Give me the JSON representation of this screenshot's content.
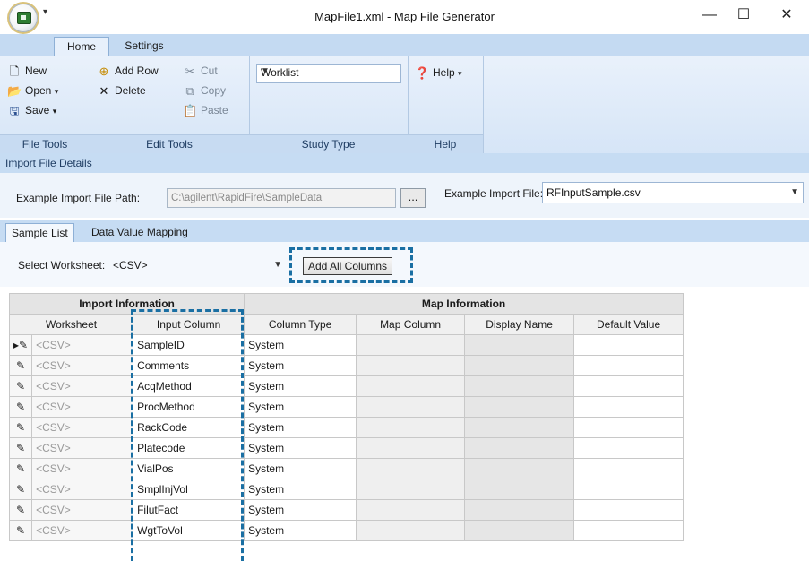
{
  "window": {
    "title": "MapFile1.xml - Map File Generator",
    "controls": {
      "minimize": "—",
      "maximize": "☐",
      "close": "✕"
    }
  },
  "ribbon": {
    "tabs": [
      "Home",
      "Settings"
    ],
    "active_tab": "Home",
    "file_tools": {
      "label": "File Tools",
      "new": "New",
      "open": "Open",
      "save": "Save"
    },
    "edit_tools": {
      "label": "Edit Tools",
      "add_row": "Add Row",
      "delete": "Delete",
      "cut": "Cut",
      "copy": "Copy",
      "paste": "Paste"
    },
    "study_type": {
      "label": "Study Type",
      "value": "Worklist"
    },
    "help": {
      "label": "Help",
      "button": "Help"
    }
  },
  "import_details": {
    "header": "Import File Details",
    "path_label": "Example Import File Path:",
    "path_value": "C:\\agilent\\RapidFire\\SampleData",
    "browse_label": "...",
    "file_label": "Example Import File:",
    "file_value": "RFInputSample.csv"
  },
  "subtabs": [
    "Sample List",
    "Data Value Mapping"
  ],
  "worksheet": {
    "label": "Select Worksheet:",
    "value": "<CSV>",
    "add_all_label": "Add All Columns"
  },
  "grid": {
    "group_headers": {
      "import": "Import Information",
      "map": "Map Information"
    },
    "columns": [
      "Worksheet",
      "Input Column",
      "Column Type",
      "Map Column",
      "Display Name",
      "Default Value"
    ],
    "rows": [
      {
        "worksheet": "<CSV>",
        "input": "SampleID",
        "type": "System"
      },
      {
        "worksheet": "<CSV>",
        "input": "Comments",
        "type": "System"
      },
      {
        "worksheet": "<CSV>",
        "input": "AcqMethod",
        "type": "System"
      },
      {
        "worksheet": "<CSV>",
        "input": "ProcMethod",
        "type": "System"
      },
      {
        "worksheet": "<CSV>",
        "input": "RackCode",
        "type": "System"
      },
      {
        "worksheet": "<CSV>",
        "input": "Platecode",
        "type": "System"
      },
      {
        "worksheet": "<CSV>",
        "input": "VialPos",
        "type": "System"
      },
      {
        "worksheet": "<CSV>",
        "input": "SmplInjVol",
        "type": "System"
      },
      {
        "worksheet": "<CSV>",
        "input": "FilutFact",
        "type": "System"
      },
      {
        "worksheet": "<CSV>",
        "input": "WgtToVol",
        "type": "System"
      }
    ]
  }
}
